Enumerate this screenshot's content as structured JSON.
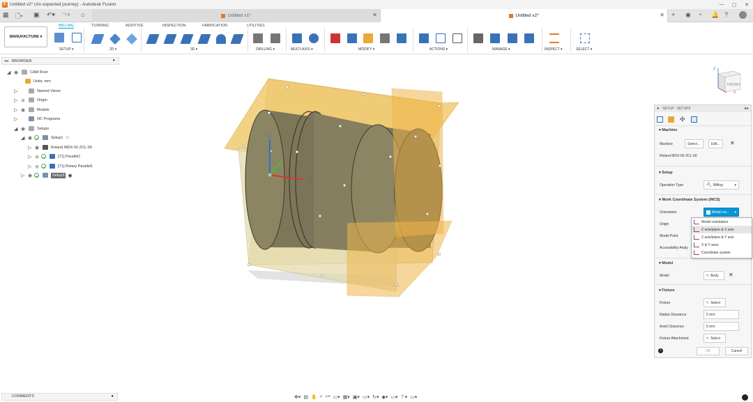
{
  "titlebar": {
    "title": "Untitled v2* (An expected journey) - Autodesk Fusion"
  },
  "tabs": [
    {
      "label": "Untitled v1*"
    },
    {
      "label": "Untitled v2*"
    }
  ],
  "ribbon": {
    "workspace": "MANUFACTURE",
    "workspace_caret": "▾",
    "tabs": [
      "MILLING",
      "TURNING",
      "ADDITIVE",
      "INSPECTION",
      "FABRICATION",
      "UTILITIES"
    ],
    "groups": [
      "SETUP ▾",
      "2D ▾",
      "3D ▾",
      "DRILLING ▾",
      "MULTI-AXIS ▾",
      "MODIFY ▾",
      "ACTIONS ▾",
      "MANAGE ▾",
      "INSPECT ▾",
      "SELECT ▾"
    ]
  },
  "browser": {
    "title": "BROWSER",
    "items": [
      {
        "label": "CAM Root"
      },
      {
        "label": "Units: mm"
      },
      {
        "label": "Named Views"
      },
      {
        "label": "Origin"
      },
      {
        "label": "Models"
      },
      {
        "label": "NC Programs"
      },
      {
        "label": "Setups"
      },
      {
        "label": "Setup1"
      },
      {
        "label": "Roland MDX-50 ZCL-50"
      },
      {
        "label": "[T1] Parallel1"
      },
      {
        "label": "[T1] Rotary Parallel1"
      },
      {
        "label": "Setup3"
      }
    ]
  },
  "viewcube": {
    "face": "FRONT",
    "axis_z": "Z",
    "axis_x": "X"
  },
  "triad": {
    "z": "Z",
    "x": "X"
  },
  "panel": {
    "title": "SETUP : SETUP3",
    "machine": {
      "header": "Machine",
      "label": "Machine",
      "select": "Select...",
      "edit": "Edit...",
      "name": "Roland MDX-50 ZCL-50"
    },
    "setup": {
      "header": "Setup",
      "op_label": "Operation Type",
      "op_value": "Milling"
    },
    "wcs": {
      "header": "Work Coordinate System (WCS)",
      "orientation_label": "Orientation",
      "orientation_value": "Model ori...",
      "origin_label": "Origin",
      "model_point_label": "Model Point",
      "accessibility_label": "Accessibility Analy"
    },
    "model": {
      "header": "Model",
      "label": "Model",
      "value": "Body"
    },
    "fixture": {
      "header": "Fixture",
      "fixture_label": "Fixture",
      "fixture_select": "Select",
      "radial_label": "Radial Clearance",
      "radial_value": "5 mm",
      "axial_label": "Axial Clearance",
      "axial_value": "5 mm",
      "attachment_label": "Fixture Attachment",
      "attachment_select": "Select"
    },
    "ok": "OK",
    "cancel": "Cancel"
  },
  "orientation_dropdown": {
    "options": [
      "Model orientation",
      "Z axis/plane & X axis",
      "Z axis/plane & Y axis",
      "X & Y axes",
      "Coordinate system"
    ]
  },
  "comments": {
    "label": "COMMENTS"
  },
  "colors": {
    "accent": "#0696d7",
    "stock": "#e8a93a",
    "part": "#7a7560"
  }
}
